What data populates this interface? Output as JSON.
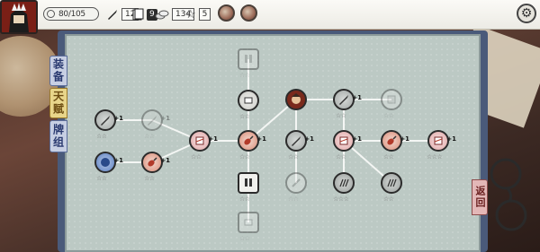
{
  "header": {
    "hp": "80/105",
    "attack_count": "12",
    "cards_count": "9",
    "gold": "134",
    "stars": "5"
  },
  "tabs": {
    "equipment": "装备",
    "talent": "天赋",
    "deck": "牌组",
    "return": "返回"
  },
  "colors": {
    "page_bg": "#bcc9c4",
    "book_cover": "#4a5a7a",
    "talent_tab": "#e8d58a",
    "return_tab": "#e3b7b7"
  },
  "talent_nodes": [
    {
      "id": "a1",
      "icon": "sword-icon",
      "plus": "+1",
      "stars": 2,
      "state": "active"
    },
    {
      "id": "a2",
      "icon": "fist-icon",
      "plus": "+1",
      "stars": 2,
      "state": "active"
    },
    {
      "id": "b1",
      "icon": "sword-icon",
      "plus": "+1",
      "stars": 2,
      "state": "locked"
    },
    {
      "id": "b2",
      "icon": "drumstick-icon",
      "plus": "+1",
      "stars": 2,
      "state": "active"
    },
    {
      "id": "c1",
      "icon": "broken-scroll-icon",
      "plus": "+1",
      "stars": 2,
      "state": "active"
    },
    {
      "id": "d0",
      "icon": "socks-icon",
      "plus": "",
      "stars": 2,
      "state": "locked"
    },
    {
      "id": "d1",
      "icon": "scroll-icon",
      "plus": "",
      "stars": 2,
      "state": "active"
    },
    {
      "id": "d2",
      "icon": "drumstick-icon",
      "plus": "+1",
      "stars": 2,
      "state": "active"
    },
    {
      "id": "d3",
      "icon": "socks-icon",
      "plus": "",
      "stars": 2,
      "state": "active"
    },
    {
      "id": "d4",
      "icon": "scroll-icon",
      "plus": "",
      "stars": 2,
      "state": "locked"
    },
    {
      "id": "e0",
      "icon": "boss-portrait-icon",
      "plus": "",
      "stars": 0,
      "state": "active"
    },
    {
      "id": "e1",
      "icon": "sword-icon",
      "plus": "+1",
      "stars": 2,
      "state": "active"
    },
    {
      "id": "e2",
      "icon": "dagger-icon",
      "plus": "",
      "stars": 2,
      "state": "locked"
    },
    {
      "id": "f1",
      "icon": "sword-icon",
      "plus": "+1",
      "stars": 2,
      "state": "active"
    },
    {
      "id": "f2",
      "icon": "broken-scroll-icon",
      "plus": "+1",
      "stars": 2,
      "state": "active"
    },
    {
      "id": "f3",
      "icon": "claw-icon",
      "plus": "",
      "stars": 3,
      "state": "active"
    },
    {
      "id": "g0",
      "icon": "shield-icon",
      "plus": "",
      "stars": 2,
      "state": "locked"
    },
    {
      "id": "g1",
      "icon": "drumstick-icon",
      "plus": "+1",
      "stars": 2,
      "state": "active"
    },
    {
      "id": "g2",
      "icon": "claw-icon",
      "plus": "",
      "stars": 2,
      "state": "active"
    },
    {
      "id": "h1",
      "icon": "broken-scroll-icon",
      "plus": "+1",
      "stars": 3,
      "state": "active"
    }
  ]
}
